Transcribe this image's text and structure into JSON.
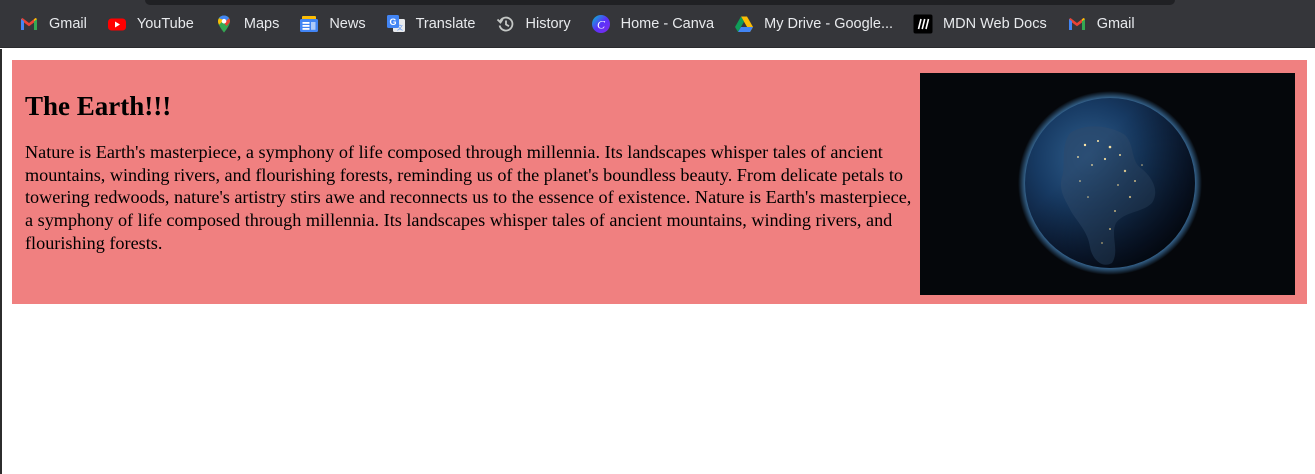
{
  "bookmarks": [
    {
      "label": "Gmail",
      "icon": "gmail-icon"
    },
    {
      "label": "YouTube",
      "icon": "youtube-icon"
    },
    {
      "label": "Maps",
      "icon": "maps-icon"
    },
    {
      "label": "News",
      "icon": "news-icon"
    },
    {
      "label": "Translate",
      "icon": "translate-icon"
    },
    {
      "label": "History",
      "icon": "history-icon"
    },
    {
      "label": "Home - Canva",
      "icon": "canva-icon"
    },
    {
      "label": "My Drive - Google...",
      "icon": "google-drive-icon"
    },
    {
      "label": "MDN Web Docs",
      "icon": "mdn-icon"
    },
    {
      "label": "Gmail",
      "icon": "gmail-icon"
    }
  ],
  "card": {
    "title": "The Earth!!!",
    "paragraph": "Nature is Earth's masterpiece, a symphony of life composed through millennia. Its landscapes whisper tales of ancient mountains, winding rivers, and flourishing forests, reminding us of the planet's boundless beauty. From delicate petals to towering redwoods, nature's artistry stirs awe and reconnects us to the essence of existence. Nature is Earth's masterpiece, a symphony of life composed through millennia. Its landscapes whisper tales of ancient mountains, winding rivers, and flourishing forests.",
    "image": "earth-from-space"
  },
  "colors": {
    "bookmarks_bar": "#35363a",
    "card_background": "#f08080",
    "bookmark_text": "#e8eaed"
  }
}
